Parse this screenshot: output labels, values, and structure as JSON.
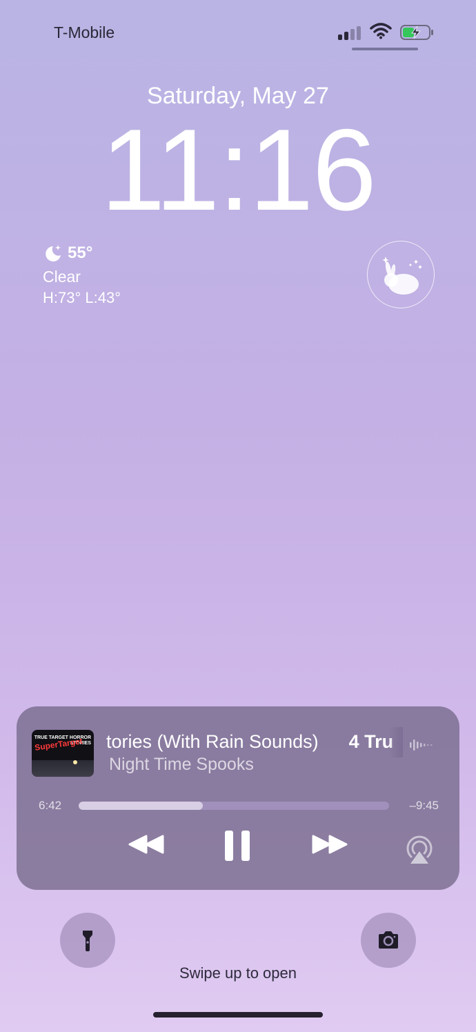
{
  "status_bar": {
    "carrier": "T-Mobile",
    "signal_bars_active": 2,
    "signal_bars_total": 4,
    "wifi": "wifi-icon",
    "battery": "battery-charging-icon"
  },
  "lockscreen": {
    "date": "Saturday, May 27",
    "time": "11:16"
  },
  "weather": {
    "icon": "moon-stars-icon",
    "temperature": "55°",
    "condition": "Clear",
    "high_low": "H:73° L:43°"
  },
  "sleep_widget": {
    "icon": "sleep-rabbit-icon"
  },
  "now_playing": {
    "title": "tories (With Rain Sounds)",
    "title_next": "4 Tru",
    "subtitle": "Night Time Spooks",
    "artwork_text_top": "TRUE TARGET HORROR STORIES",
    "artwork_text_sign": "SuperTarget",
    "elapsed": "6:42",
    "remaining": "–9:45",
    "progress": 0.4,
    "controls": [
      "rewind-icon",
      "pause-icon",
      "fast-forward-icon",
      "airplay-icon"
    ]
  },
  "quick_actions": {
    "flashlight": "flashlight-icon",
    "camera": "camera-icon"
  },
  "swipe_hint": "Swipe up to open",
  "colors": {
    "background_top": "#b9b4e4",
    "background_bottom": "#e0cbf2",
    "player_bg": "#6e6282",
    "text_dark": "#2a2738"
  }
}
